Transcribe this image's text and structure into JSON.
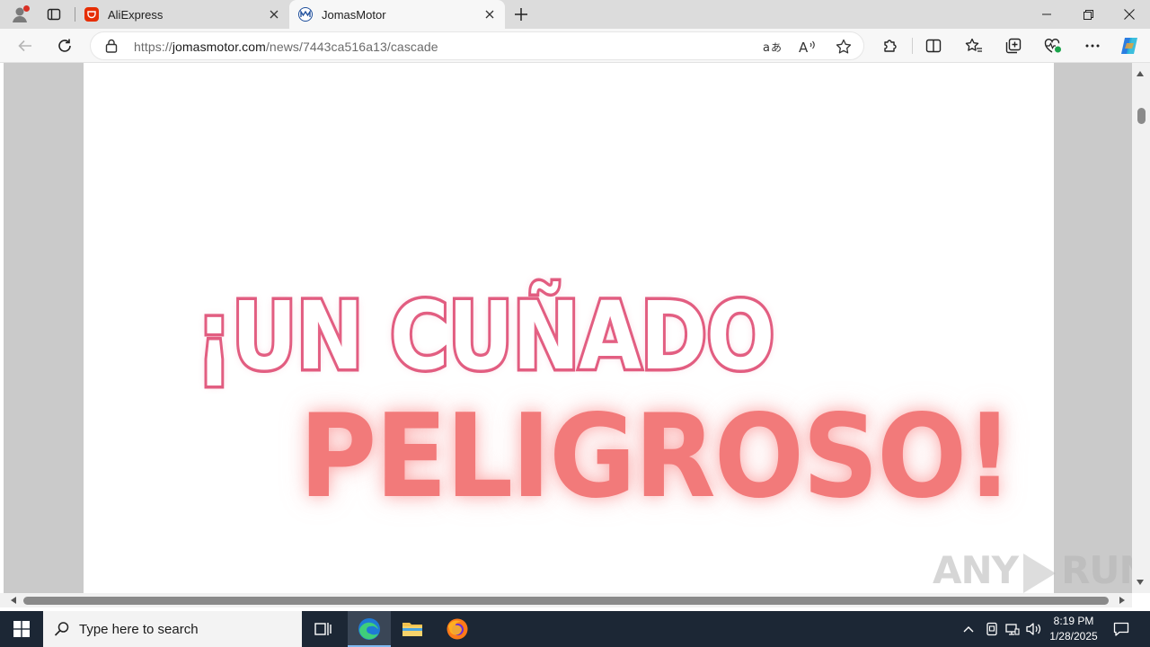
{
  "browser": {
    "tabs": [
      {
        "title": "AliExpress",
        "favicon": "aliexpress-icon",
        "active": false
      },
      {
        "title": "JomasMotor",
        "favicon": "jomasmotor-icon",
        "active": true
      }
    ],
    "url": {
      "scheme": "https://",
      "host": "jomasmotor.com",
      "path": "/news/7443ca516a13/cascade"
    }
  },
  "page": {
    "headline_line1": "¡UN CUÑADO",
    "headline_line2": "PELIGROSO!",
    "watermark_left": "ANY",
    "watermark_right": "RUN"
  },
  "taskbar": {
    "search_placeholder": "Type here to search",
    "time": "8:19 PM",
    "date": "1/28/2025"
  },
  "colors": {
    "headline1_fill": "#ffffff",
    "headline1_stroke": "#e05a7e",
    "headline2_fill": "#f27a7a",
    "taskbar_bg": "#1c2735"
  }
}
